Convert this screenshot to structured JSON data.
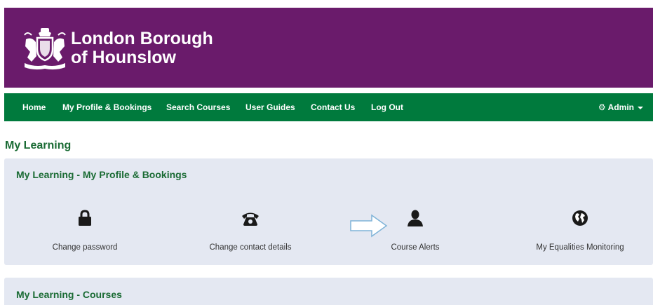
{
  "header": {
    "title_line1": "London Borough",
    "title_line2": "of Hounslow",
    "crest_icon": "borough-crest-icon",
    "background_color": "#6a1b6b"
  },
  "nav": {
    "background_color": "#007a3d",
    "items": [
      {
        "label": "Home"
      },
      {
        "label": "My Profile & Bookings"
      },
      {
        "label": "Search Courses"
      },
      {
        "label": "User Guides"
      },
      {
        "label": "Contact Us"
      },
      {
        "label": "Log Out"
      }
    ],
    "admin": {
      "icon": "gear-icon",
      "label": "Admin",
      "caret_icon": "caret-down-icon"
    }
  },
  "page": {
    "title": "My Learning"
  },
  "panels": {
    "profile": {
      "title": "My Learning - My Profile & Bookings",
      "tiles": [
        {
          "label": "Change password",
          "icon": "lock-icon"
        },
        {
          "label": "Change contact details",
          "icon": "phone-icon"
        },
        {
          "label": "Course Alerts",
          "icon": "user-icon"
        },
        {
          "label": "My Equalities Monitoring",
          "icon": "globe-icon"
        }
      ]
    },
    "courses": {
      "title": "My Learning - Courses"
    }
  },
  "annotation": {
    "arrow_icon": "arrow-right-outline-icon",
    "arrow_color": "#7fb3d8"
  }
}
